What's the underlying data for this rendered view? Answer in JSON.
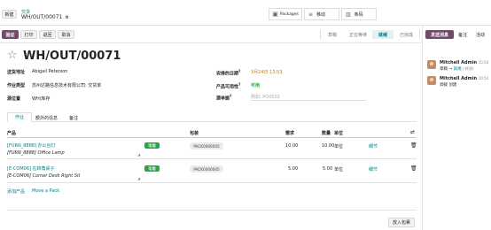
{
  "topbar": {
    "new_label": "新建",
    "breadcrumb_parent": "交货",
    "record_ref": "WH/OUT/00071",
    "smart_buttons": {
      "packages": "Packages",
      "moves": "移动",
      "barcode": "条码"
    }
  },
  "actions": {
    "validate": "验证",
    "print": "打印",
    "return": "退回",
    "cancel": "取消"
  },
  "stages": [
    "草稿",
    "正在等待",
    "就绪",
    "已完成"
  ],
  "chatter_buttons": {
    "send_message": "发送消息",
    "log_note": "备注",
    "activity": "活动"
  },
  "form": {
    "title": "WH/OUT/00071",
    "fields": {
      "delivery_address_label": "送货地址",
      "delivery_address": "Abigail Peterson",
      "operation_type_label": "作业类型",
      "operation_type": "苏州达路信息技术有限公司: 交货单",
      "source_location_label": "源位置",
      "source_location": "WH/库存",
      "scheduled_date_label": "安排的日期",
      "scheduled_date": "3月24日 13:53",
      "product_availability_label": "产品可用性",
      "product_availability": "可用",
      "source_document_label": "源单据",
      "source_document_placeholder": "例如: PO0032"
    },
    "tabs": [
      "作业",
      "额外的信息",
      "备注"
    ],
    "table": {
      "headers": {
        "product": "产品",
        "package": "包装",
        "demand": "需求",
        "quantity": "数量",
        "unit": "单位"
      },
      "rows": [
        {
          "product_code": "[FURN_8888] 办公台灯",
          "description": "[FURN_8888] Office Lamp",
          "status": "可用",
          "package": "PACK0000005",
          "demand": "10.00",
          "quantity": "10.00",
          "unit": "单位",
          "details": "细节"
        },
        {
          "product_code": "[E-COM06] 右转角桌子",
          "description": "[E-COM06] Corner Desk Right Sit",
          "status": "可用",
          "package": "PACK0000005",
          "demand": "5.00",
          "quantity": "5.00",
          "unit": "单位",
          "details": "细节"
        }
      ],
      "add_product": "添加产品",
      "move_pack": "Move a Pack"
    },
    "put_in_pack": "放入包裹"
  },
  "chatter": [
    {
      "author": "Mitchell Admin",
      "time": "10:54",
      "change_from": "草稿",
      "change_to": "就绪",
      "field": "(状态)"
    },
    {
      "author": "Mitchell Admin",
      "time": "10:54",
      "text": "调拨 创建"
    }
  ]
}
